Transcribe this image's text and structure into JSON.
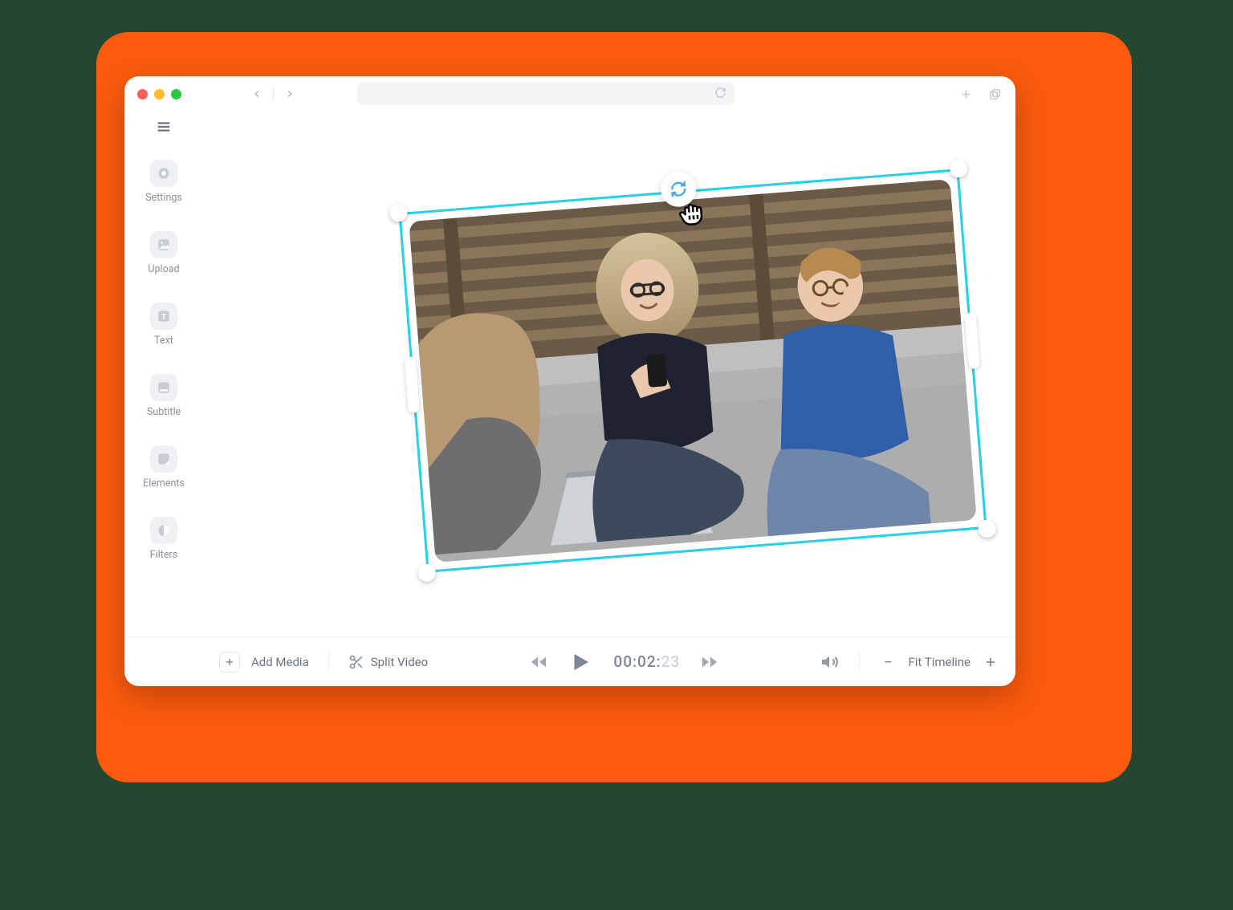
{
  "sidebar": {
    "items": [
      {
        "label": "Settings",
        "icon": "settings-icon"
      },
      {
        "label": "Upload",
        "icon": "upload-icon"
      },
      {
        "label": "Text",
        "icon": "text-icon"
      },
      {
        "label": "Subtitle",
        "icon": "subtitle-icon"
      },
      {
        "label": "Elements",
        "icon": "elements-icon"
      },
      {
        "label": "Filters",
        "icon": "filters-icon"
      }
    ]
  },
  "toolbar": {
    "add_media_label": "Add Media",
    "split_video_label": "Split Video",
    "fit_timeline_label": "Fit Timeline",
    "plus_glyph": "+",
    "minus_glyph": "−"
  },
  "timecode": {
    "main": "00:02:",
    "frames": "23"
  },
  "selection": {
    "accent_color": "#26d0e6",
    "rotated_deg": -4.5
  },
  "window": {
    "brand_color": "#fc5b0d"
  }
}
